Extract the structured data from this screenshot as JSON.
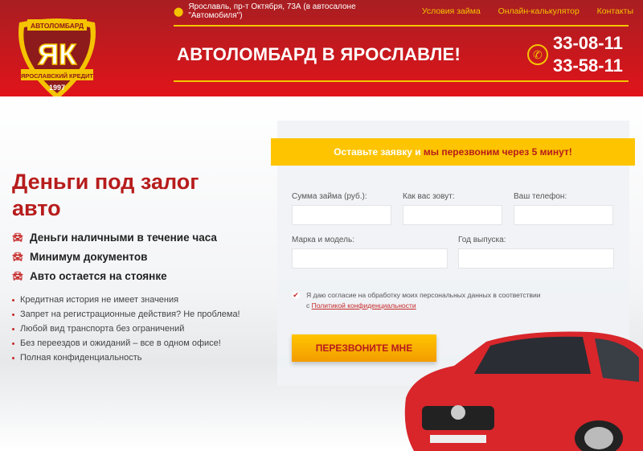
{
  "header": {
    "address": "Ярославль, пр-т Октября, 73А (в автосалоне \"Автомобиля\")",
    "nav": [
      "Условия займа",
      "Онлайн-калькулятор",
      "Контакты"
    ],
    "title": "АВТОЛОМБАРД В ЯРОСЛАВЛЕ!",
    "phones": [
      "33-08-11",
      "33-58-11"
    ]
  },
  "logo": {
    "top": "АВТОЛОМБАРД",
    "letters": "ЯК",
    "bottom": "ЯРОСЛАВСКИЙ КРЕДИТ",
    "year": "1997"
  },
  "hero": {
    "title": "Деньги под залог авто",
    "features": [
      "Деньги наличными в течение часа",
      "Минимум документов",
      "Авто остается на стоянке"
    ],
    "bullets": [
      "Кредитная история не имеет значения",
      "Запрет на регистрационные действия? Не проблема!",
      "Любой вид транспорта без ограничений",
      "Без переездов и ожиданий – все в одном офисе!",
      "Полная конфиденциальность"
    ]
  },
  "form": {
    "ribbon_white": "Оставьте заявку и ",
    "ribbon_red": "мы перезвоним через 5 минут!",
    "fields": {
      "amount": "Сумма займа (руб.):",
      "name": "Как вас зовут:",
      "phone": "Ваш телефон:",
      "model": "Марка и модель:",
      "year": "Год выпуска:"
    },
    "consent": "Я даю согласие на обработку моих персональных данных в соответствии",
    "consent_prefix": "с ",
    "consent_link": "Политикой конфиденциальности",
    "submit": "ПЕРЕЗВОНИТЕ МНЕ"
  }
}
